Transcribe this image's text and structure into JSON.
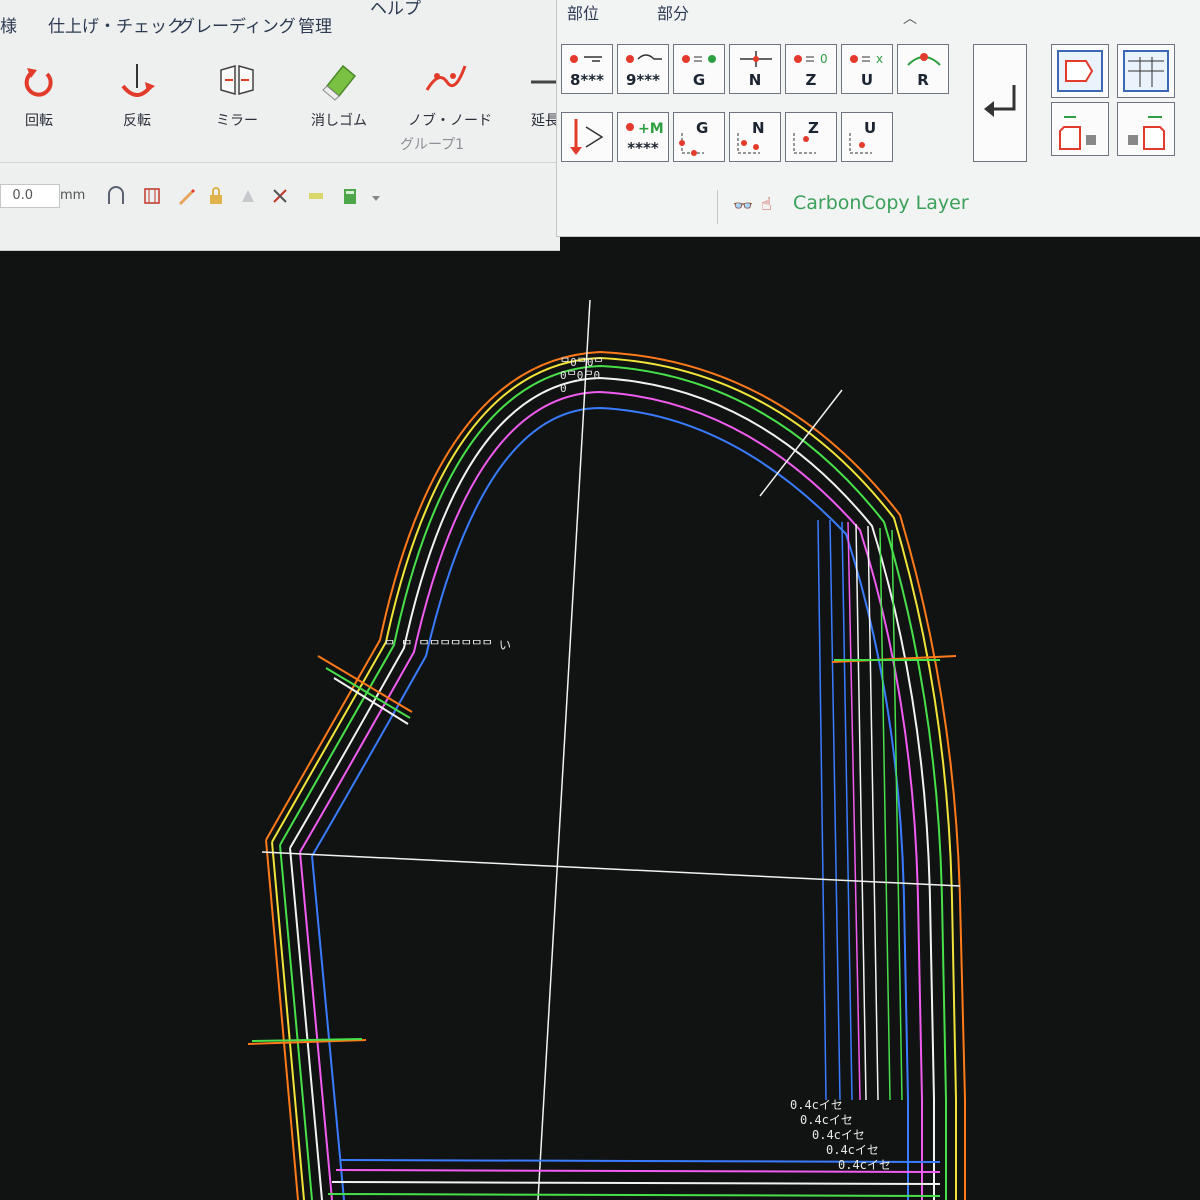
{
  "menu": {
    "tabs": [
      "様",
      "仕上げ・チェック",
      "グレーディング",
      "管理",
      "ヘルプ"
    ]
  },
  "ribbon": {
    "buttons": [
      {
        "label": "回転",
        "icon": "rotate-icon"
      },
      {
        "label": "反転",
        "icon": "flip-icon"
      },
      {
        "label": "ミラー",
        "icon": "mirror-icon"
      },
      {
        "label": "消しゴム",
        "icon": "eraser-icon"
      },
      {
        "label": "ノブ・ノード",
        "icon": "node-icon"
      },
      {
        "label": "延長",
        "icon": "extend-icon"
      }
    ],
    "group_label": "グループ1"
  },
  "toolbar": {
    "value": "0.0",
    "unit": "mm"
  },
  "right_panel": {
    "tabs": [
      "部位",
      "部分"
    ],
    "collapse_icon": "chevron-up-icon",
    "commands_row1": [
      {
        "label": "8***",
        "icon": "pattern-8-icon"
      },
      {
        "label": "9***",
        "icon": "pattern-9-icon"
      },
      {
        "label": "G",
        "icon": "grade-g-icon"
      },
      {
        "label": "N",
        "icon": "grade-n-icon"
      },
      {
        "label": "Z",
        "icon": "grade-z-icon"
      },
      {
        "label": "U",
        "icon": "grade-u-icon"
      },
      {
        "label": "R",
        "icon": "grade-r-icon"
      }
    ],
    "commands_row2": [
      {
        "label": "",
        "icon": "split-icon"
      },
      {
        "label": "****",
        "icon": "plus-m-icon"
      },
      {
        "label": "G",
        "icon": "point-g-icon"
      },
      {
        "label": "N",
        "icon": "point-n-icon"
      },
      {
        "label": "Z",
        "icon": "point-z-icon"
      },
      {
        "label": "U",
        "icon": "point-u-icon"
      }
    ],
    "plus_m_label": "+M",
    "enter_icon": "enter-icon",
    "layer_label": "CarbonCopy Layer",
    "layer_icons": [
      "glasses-icon",
      "hand-icon"
    ]
  },
  "canvas": {
    "colors": {
      "background": "#111312",
      "orange": "#ff7a1a",
      "yellow": "#f0e43a",
      "green": "#48e04a",
      "white": "#f2f2f2",
      "magenta": "#f05cf0",
      "blue": "#3a7cff"
    },
    "annotation_top": "ᄆ ᄆ ᄆᄆᄆᄆᄆᄆᄆ い",
    "vertical_numbers": "ᄆ0ᄆ0ᄆ0ᄆ0ᄆ00",
    "seam_labels": [
      "0.4cイセ",
      "0.4cイセ",
      "0.4cイセ",
      "0.4cイセ",
      "0.4cイセ"
    ]
  }
}
